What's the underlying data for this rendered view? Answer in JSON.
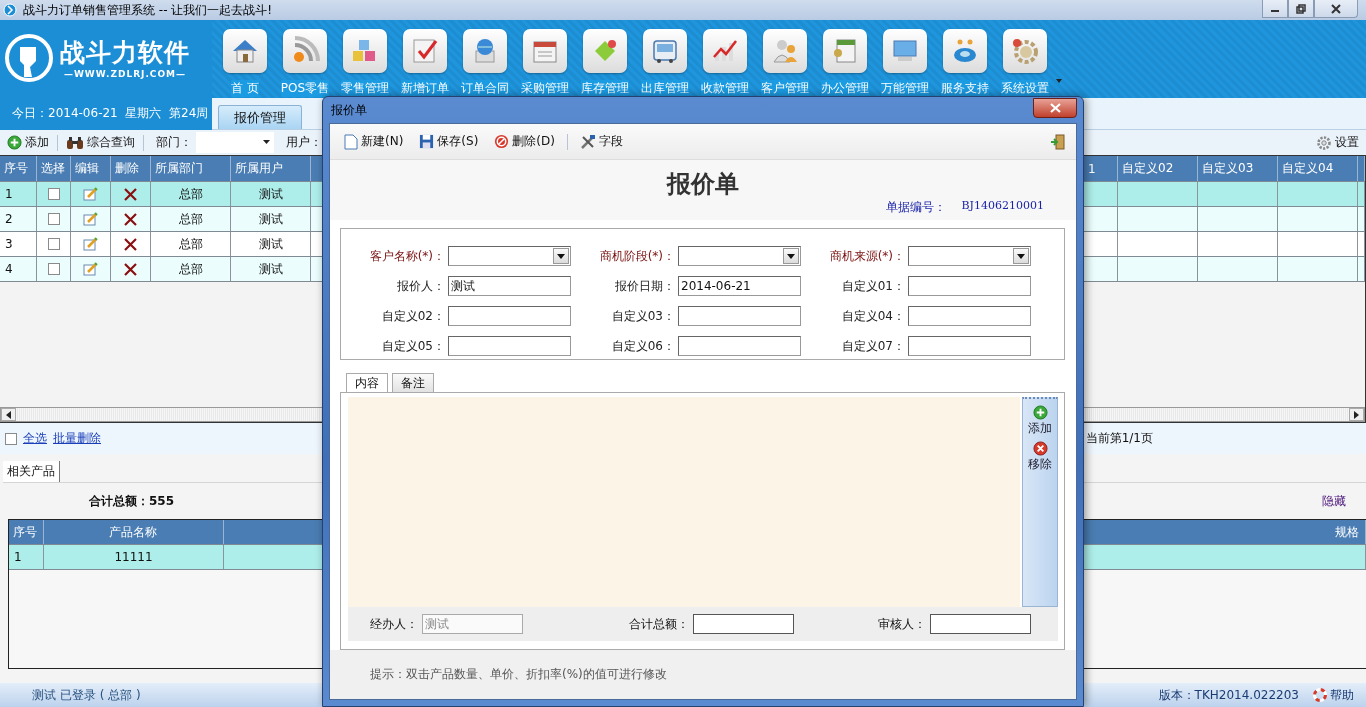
{
  "window": {
    "title": "战斗力订单销售管理系统 -- 让我们一起去战斗!"
  },
  "brand": {
    "name": "战斗力软件",
    "url": "—WWW.ZDLRJ.COM—",
    "date": "今日：2014-06-21  星期六  第24周"
  },
  "nav": [
    {
      "label": "首 页",
      "kind": "home"
    },
    {
      "label": "POS零售",
      "kind": "pos"
    },
    {
      "label": "零售管理",
      "kind": "retail"
    },
    {
      "label": "新增订单",
      "kind": "order"
    },
    {
      "label": "订单合同",
      "kind": "contract"
    },
    {
      "label": "采购管理",
      "kind": "purchase"
    },
    {
      "label": "库存管理",
      "kind": "stock"
    },
    {
      "label": "出库管理",
      "kind": "outbound"
    },
    {
      "label": "收款管理",
      "kind": "payment"
    },
    {
      "label": "客户管理",
      "kind": "customer"
    },
    {
      "label": "办公管理",
      "kind": "office"
    },
    {
      "label": "万能管理",
      "kind": "universal"
    },
    {
      "label": "服务支持",
      "kind": "service"
    },
    {
      "label": "系统设置",
      "kind": "settings"
    }
  ],
  "module_tabs": [
    {
      "label": "报价管理",
      "selected": true
    }
  ],
  "toolbar": {
    "add": "添加",
    "query": "综合查询",
    "dept_label": "部门：",
    "user_label": "用户：",
    "settings": "设置"
  },
  "grid": {
    "columns": [
      "序号",
      "选择",
      "编辑",
      "删除",
      "所属部门",
      "所属用户"
    ],
    "right_columns": [
      "1",
      "自定义02",
      "自定义03",
      "自定义04"
    ],
    "rows": [
      {
        "no": "1",
        "checked": false,
        "selected": true,
        "dept": "总部",
        "user": "测试"
      },
      {
        "no": "2",
        "checked": false,
        "selected": false,
        "dept": "总部",
        "user": "测试"
      },
      {
        "no": "3",
        "checked": false,
        "selected": false,
        "dept": "总部",
        "user": "测试"
      },
      {
        "no": "4",
        "checked": false,
        "selected": false,
        "dept": "总部",
        "user": "测试"
      }
    ]
  },
  "bulk": {
    "checked": false,
    "select_all": "全选",
    "batch_delete": "批量删除",
    "page": "当前第1/1页"
  },
  "detail": {
    "tabs": [
      {
        "label": "相关产品",
        "selected": true
      }
    ],
    "total": "合计总额：555",
    "hide": "隐藏",
    "columns": [
      "序号",
      "产品名称",
      "规格"
    ],
    "rows": [
      {
        "no": "1",
        "name": "11111",
        "selected": true
      }
    ]
  },
  "status_bar": {
    "user": "测试 已登录 ( 总部 )",
    "version": "版本：TKH2014.022203",
    "help": "帮助"
  },
  "dialog": {
    "title": "报价单",
    "toolbar": [
      {
        "label": "新建(N)",
        "kind": "new"
      },
      {
        "label": "保存(S)",
        "kind": "save"
      },
      {
        "label": "删除(D)",
        "kind": "delete"
      },
      {
        "label": "字段",
        "kind": "fields"
      }
    ],
    "heading": "报价单",
    "number_label": "单据编号：",
    "number": "BJ1406210001",
    "fields": [
      {
        "label": "客户名称(*)：",
        "required": true,
        "kind": "select"
      },
      {
        "label": "商机阶段(*)：",
        "required": true,
        "kind": "select"
      },
      {
        "label": "商机来源(*)：",
        "required": true,
        "kind": "select"
      },
      {
        "label": "报价人：",
        "required": false,
        "kind": "text",
        "value": "测试"
      },
      {
        "label": "报价日期：",
        "required": false,
        "kind": "text",
        "value": "2014-06-21"
      },
      {
        "label": "自定义01：",
        "required": false,
        "kind": "text"
      },
      {
        "label": "自定义02：",
        "required": false,
        "kind": "text"
      },
      {
        "label": "自定义03：",
        "required": false,
        "kind": "text"
      },
      {
        "label": "自定义04：",
        "required": false,
        "kind": "text"
      },
      {
        "label": "自定义05：",
        "required": false,
        "kind": "text"
      },
      {
        "label": "自定义06：",
        "required": false,
        "kind": "text"
      },
      {
        "label": "自定义07：",
        "required": false,
        "kind": "text"
      }
    ],
    "content_tabs": [
      {
        "label": "内容",
        "selected": true
      },
      {
        "label": "备注",
        "selected": false
      }
    ],
    "side_buttons": [
      {
        "label": "添加",
        "kind": "add"
      },
      {
        "label": "移除",
        "kind": "remove"
      }
    ],
    "footer_fields": [
      {
        "label": "经办人：",
        "value": "测试",
        "disabled": true
      },
      {
        "label": "合计总额：",
        "disabled": false
      },
      {
        "label": "审核人：",
        "disabled": false
      }
    ],
    "hint": "提示：双击产品数量、单价、折扣率(%)的值可进行修改"
  }
}
